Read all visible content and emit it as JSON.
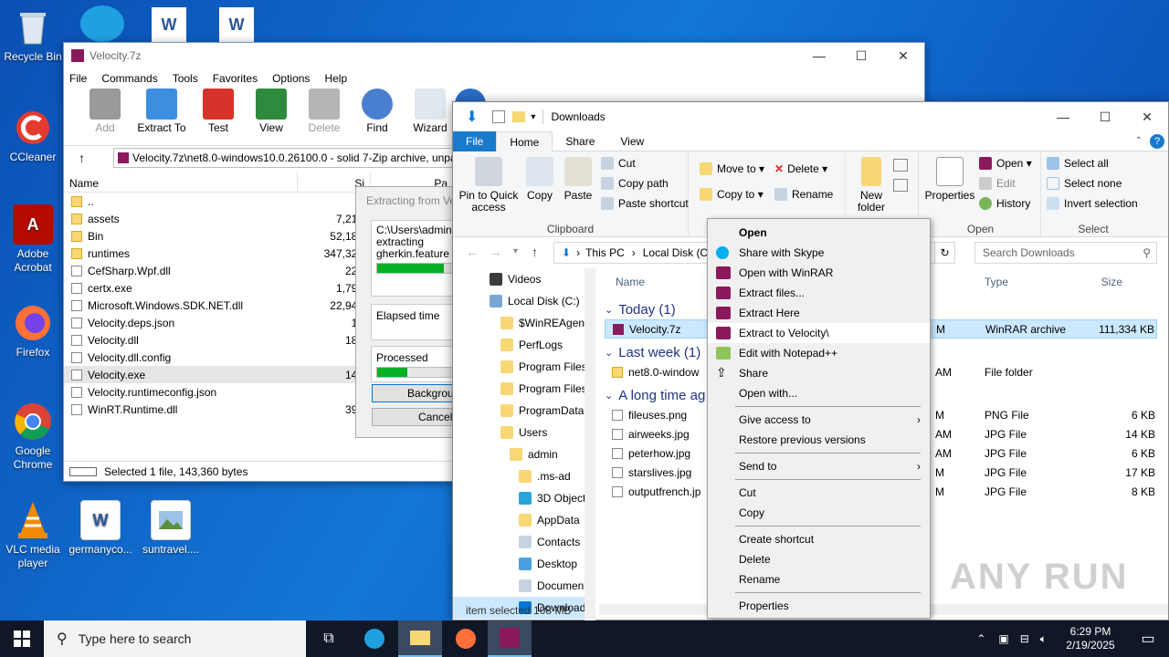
{
  "desktop": {
    "icons": [
      {
        "label": "Recycle Bin"
      },
      {
        "label": "CCleaner"
      },
      {
        "label": "Adobe Acrobat"
      },
      {
        "label": "Firefox"
      },
      {
        "label": "Google Chrome"
      },
      {
        "label": "VLC media player"
      },
      {
        "label": "germanyco..."
      },
      {
        "label": "suntravel...."
      }
    ]
  },
  "winrar": {
    "title": "Velocity.7z",
    "menu": [
      "File",
      "Commands",
      "Tools",
      "Favorites",
      "Options",
      "Help"
    ],
    "toolbar": [
      "Add",
      "Extract To",
      "Test",
      "View",
      "Delete",
      "Find",
      "Wizard",
      "In"
    ],
    "address": "Velocity.7z\\net8.0-windows10.0.26100.0 - solid 7-Zip archive, unpa",
    "columns": {
      "name": "Name",
      "size": "Si",
      "packed": "Pa"
    },
    "files": [
      {
        "name": "..",
        "size": ""
      },
      {
        "name": "assets",
        "size": "7,213,1"
      },
      {
        "name": "Bin",
        "size": "52,182,8"
      },
      {
        "name": "runtimes",
        "size": "347,324,0"
      },
      {
        "name": "CefSharp.Wpf.dll",
        "size": "225,2"
      },
      {
        "name": "certx.exe",
        "size": "1,797,7"
      },
      {
        "name": "Microsoft.Windows.SDK.NET.dll",
        "size": "22,940,1"
      },
      {
        "name": "Velocity.deps.json",
        "size": "18,0"
      },
      {
        "name": "Velocity.dll",
        "size": "184,8"
      },
      {
        "name": "Velocity.dll.config",
        "size": "1,1"
      },
      {
        "name": "Velocity.exe",
        "size": "143,3"
      },
      {
        "name": "Velocity.runtimeconfig.json",
        "size": "4"
      },
      {
        "name": "WinRT.Runtime.dll",
        "size": "399,7"
      }
    ],
    "status": "Selected 1 file, 143,360 bytes"
  },
  "extract_dialog": {
    "title": "Extracting from Ve",
    "path": "C:\\Users\\admin\\D",
    "action": "extracting",
    "file": "gherkin.feature",
    "file_progress": 0.85,
    "elapsed_label": "Elapsed time",
    "processed_label": "Processed",
    "processed_progress": 0.38,
    "background_btn": "Background",
    "cancel_btn": "Cancel"
  },
  "explorer": {
    "title": "Downloads",
    "tabs": [
      "File",
      "Home",
      "Share",
      "View"
    ],
    "clipboard": {
      "pin": "Pin to Quick access",
      "copy": "Copy",
      "paste": "Paste",
      "cut": "Cut",
      "copy_path": "Copy path",
      "paste_shortcut": "Paste shortcut",
      "label": "Clipboard"
    },
    "organize": {
      "move_to": "Move to",
      "copy_to": "Copy to",
      "delete": "Delete",
      "rename": "Rename"
    },
    "new": {
      "new_folder": "New folder"
    },
    "open": {
      "properties": "Properties",
      "open": "Open",
      "edit": "Edit",
      "history": "History",
      "label": "Open"
    },
    "select": {
      "select_all": "Select all",
      "select_none": "Select none",
      "invert": "Invert selection",
      "label": "Select"
    },
    "breadcrumb": [
      "This PC",
      "Local Disk (C"
    ],
    "search_placeholder": "Search Downloads",
    "nav": [
      "Videos",
      "Local Disk (C:)",
      "$WinREAgent",
      "PerfLogs",
      "Program Files",
      "Program Files",
      "ProgramData",
      "Users",
      "admin",
      ".ms-ad",
      "3D Objects",
      "AppData",
      "Contacts",
      "Desktop",
      "Documents",
      "Downloads"
    ],
    "columns": {
      "name": "Name",
      "type": "Type",
      "size": "Size"
    },
    "groups": {
      "today": "Today (1)",
      "last_week": "Last week (1)",
      "long_ago": "A long time ag"
    },
    "rows": {
      "velocity": {
        "name": "Velocity.7z",
        "date": "M",
        "type": "WinRAR archive",
        "size": "111,334 KB"
      },
      "net8": {
        "name": "net8.0-window",
        "date": "AM",
        "type": "File folder",
        "size": ""
      },
      "fileuses": {
        "name": "fileuses.png",
        "date": "M",
        "type": "PNG File",
        "size": "6 KB"
      },
      "airweeks": {
        "name": "airweeks.jpg",
        "date": "AM",
        "type": "JPG File",
        "size": "14 KB"
      },
      "peterhow": {
        "name": "peterhow.jpg",
        "date": "AM",
        "type": "JPG File",
        "size": "6 KB"
      },
      "starslives": {
        "name": "starslives.jpg",
        "date": "M",
        "type": "JPG File",
        "size": "17 KB"
      },
      "outputfrench": {
        "name": "outputfrench.jp",
        "date": "M",
        "type": "JPG File",
        "size": "8 KB"
      }
    },
    "statusbar": "item selected  108 MB"
  },
  "context_menu": {
    "open": "Open",
    "skype": "Share with Skype",
    "open_winrar": "Open with WinRAR",
    "extract_files": "Extract files...",
    "extract_here": "Extract Here",
    "extract_to": "Extract to Velocity\\",
    "notepad": "Edit with Notepad++",
    "share": "Share",
    "open_with": "Open with...",
    "give_access": "Give access to",
    "restore": "Restore previous versions",
    "send_to": "Send to",
    "cut": "Cut",
    "copy": "Copy",
    "create_shortcut": "Create shortcut",
    "delete": "Delete",
    "rename": "Rename",
    "properties": "Properties"
  },
  "taskbar": {
    "search_placeholder": "Type here to search",
    "time": "6:29 PM",
    "date": "2/19/2025"
  },
  "watermark": "ANY RUN",
  "colors": {
    "accent": "#0078d7",
    "selection": "#cce8ff",
    "progress": "#06b025",
    "taskbar": "#101827"
  }
}
